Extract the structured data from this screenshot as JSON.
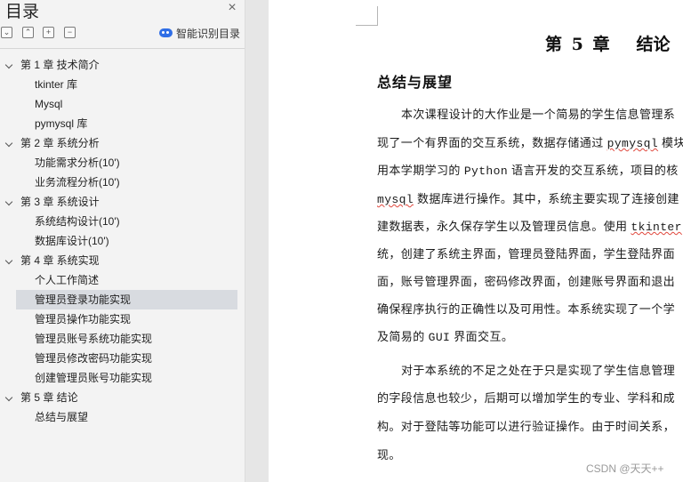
{
  "nav": {
    "title": "目录",
    "close_glyph": "×",
    "toolbar": {
      "collapse_all": "⌄",
      "expand_up": "⌃",
      "add_glyph": "+",
      "remove_glyph": "−",
      "smart_label": "智能识别目录"
    },
    "toc": [
      {
        "level": 1,
        "text": "第 1 章  技术简介",
        "expanded": true
      },
      {
        "level": 2,
        "text": "tkinter 库"
      },
      {
        "level": 2,
        "text": "Mysql"
      },
      {
        "level": 2,
        "text": "pymysql 库"
      },
      {
        "level": 1,
        "text": "第 2 章  系统分析",
        "expanded": true
      },
      {
        "level": 2,
        "text": "功能需求分析(10')"
      },
      {
        "level": 2,
        "text": "业务流程分析(10')"
      },
      {
        "level": 1,
        "text": "第 3 章  系统设计",
        "expanded": true
      },
      {
        "level": 2,
        "text": "系统结构设计(10')"
      },
      {
        "level": 2,
        "text": "数据库设计(10')"
      },
      {
        "level": 1,
        "text": "第 4 章  系统实现",
        "expanded": true
      },
      {
        "level": 2,
        "text": "个人工作简述"
      },
      {
        "level": 2,
        "text": "管理员登录功能实现",
        "selected": true
      },
      {
        "level": 2,
        "text": "管理员操作功能实现"
      },
      {
        "level": 2,
        "text": "管理员账号系统功能实现"
      },
      {
        "level": 2,
        "text": "管理员修改密码功能实现"
      },
      {
        "level": 2,
        "text": "创建管理员账号功能实现"
      },
      {
        "level": 1,
        "text": "第 5 章  结论",
        "expanded": true
      },
      {
        "level": 2,
        "text": "总结与展望"
      }
    ]
  },
  "doc": {
    "chapter_num": "第 5 章",
    "chapter_name": "结论",
    "section_title": "总结与展望",
    "lines": [
      [
        "本次课程设计的大作业是一个简易的学生信息管理系"
      ],
      [
        "现了一个有界面的交互系统，数据存储通过 ",
        "pymysql",
        " 模块"
      ],
      [
        "用本学期学习的 ",
        "Python",
        " 语言开发的交互系统，项目的核"
      ],
      [
        "mysql",
        " 数据库进行操作。其中，系统主要实现了连接创建"
      ],
      [
        "建数据表，永久保存学生以及管理员信息。使用 ",
        "tkinter"
      ],
      [
        "统，创建了系统主界面，管理员登陆界面，学生登陆界面"
      ],
      [
        "面，账号管理界面，密码修改界面，创建账号界面和退出"
      ],
      [
        "确保程序执行的正确性以及可用性。本系统实现了一个学"
      ],
      [
        "及简易的 ",
        "GUI",
        " 界面交互。"
      ],
      [
        "对于本系统的不足之处在于只是实现了学生信息管理"
      ],
      [
        "的字段信息也较少，后期可以增加学生的专业、学科和成"
      ],
      [
        "构。对于登陆等功能可以进行验证操作。由于时间关系，"
      ],
      [
        "现。"
      ]
    ],
    "watermark": "CSDN @天天++"
  }
}
